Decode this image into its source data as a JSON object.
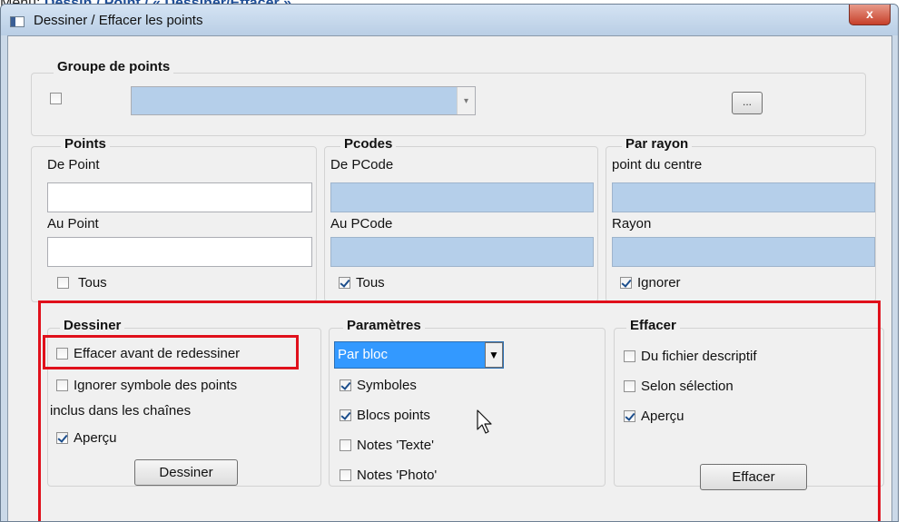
{
  "caption": {
    "prefix": "Menu:",
    "path": "Dessin / Point / « Dessiner/Effacer »"
  },
  "window": {
    "title": "Dessiner / Effacer les points",
    "close_glyph": "x"
  },
  "groupe_points": {
    "title": "Groupe de points",
    "checkbox_checked": false,
    "combo_value": "",
    "combo_arrow": "▾",
    "browse_label": "..."
  },
  "points": {
    "title": "Points",
    "from_label": "De Point",
    "from_value": "",
    "to_label": "Au Point",
    "to_value": "",
    "all_label": "Tous",
    "all_checked": false
  },
  "pcodes": {
    "title": "Pcodes",
    "from_label": "De PCode",
    "from_value": "",
    "to_label": "Au PCode",
    "to_value": "",
    "all_label": "Tous",
    "all_checked": true
  },
  "par_rayon": {
    "title": "Par rayon",
    "center_label": "point du centre",
    "center_value": "",
    "radius_label": "Rayon",
    "radius_value": "",
    "ignore_label": "Ignorer",
    "ignore_checked": true
  },
  "dessiner": {
    "title": "Dessiner",
    "erase_before_label": "Effacer avant de redessiner",
    "erase_before_checked": false,
    "ignore_symbol_label": "Ignorer symbole des points",
    "ignore_symbol_label2": "inclus dans les chaînes",
    "ignore_symbol_checked": false,
    "preview_label": "Aperçu",
    "preview_checked": true,
    "button_label": "Dessiner"
  },
  "parametres": {
    "title": "Paramètres",
    "mode_value": "Par bloc",
    "mode_arrow": "▼",
    "options": [
      {
        "label": "Symboles",
        "checked": true
      },
      {
        "label": "Blocs points",
        "checked": true
      },
      {
        "label": "Notes 'Texte'",
        "checked": false
      },
      {
        "label": "Notes 'Photo'",
        "checked": false
      }
    ]
  },
  "effacer": {
    "title": "Effacer",
    "descriptive_label": "Du fichier descriptif",
    "descriptive_checked": false,
    "selection_label": "Selon sélection",
    "selection_checked": false,
    "preview_label": "Aperçu",
    "preview_checked": true,
    "button_label": "Effacer"
  },
  "colors": {
    "highlight": "#e0101b",
    "field_blue": "#b5cfea",
    "combo_blue": "#3399ff"
  }
}
